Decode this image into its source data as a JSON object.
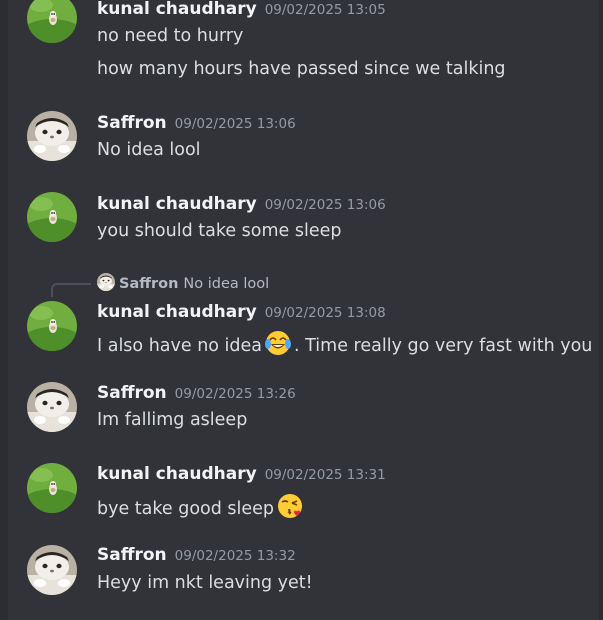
{
  "messages": [
    {
      "author": "kunal chaudhary",
      "time": "09/02/2025 13:05",
      "lines": [
        "no need to hurry",
        "how many hours have passed since we talking"
      ],
      "avatar": "frog-avatar"
    },
    {
      "author": "Saffron",
      "time": "09/02/2025 13:06",
      "lines": [
        "No idea lool"
      ],
      "avatar": "cat-avatar"
    },
    {
      "author": "kunal chaudhary",
      "time": "09/02/2025 13:06",
      "lines": [
        "you should take some sleep"
      ],
      "avatar": "frog-avatar"
    },
    {
      "author": "kunal chaudhary",
      "time": "09/02/2025 13:08",
      "reply": {
        "author": "Saffron",
        "text": "No idea lool"
      },
      "text_before": "I also have no idea",
      "emoji": "joy-emoji",
      "text_after": ". Time really go  very fast with you",
      "avatar": "frog-avatar"
    },
    {
      "author": "Saffron",
      "time": "09/02/2025 13:26",
      "lines": [
        "Im fallimg asleep"
      ],
      "avatar": "cat-avatar"
    },
    {
      "author": "kunal chaudhary",
      "time": "09/02/2025 13:31",
      "text_before": "bye take good sleep",
      "emoji": "kissing-heart-emoji",
      "avatar": "frog-avatar"
    },
    {
      "author": "Saffron",
      "time": "09/02/2025 13:32",
      "lines": [
        "Heyy im nkt leaving yet!"
      ],
      "avatar": "cat-avatar"
    }
  ],
  "colors": {
    "background": "#313338",
    "author": "#f2f3f5",
    "timestamp": "#949ba4",
    "text": "#dbdee1"
  }
}
